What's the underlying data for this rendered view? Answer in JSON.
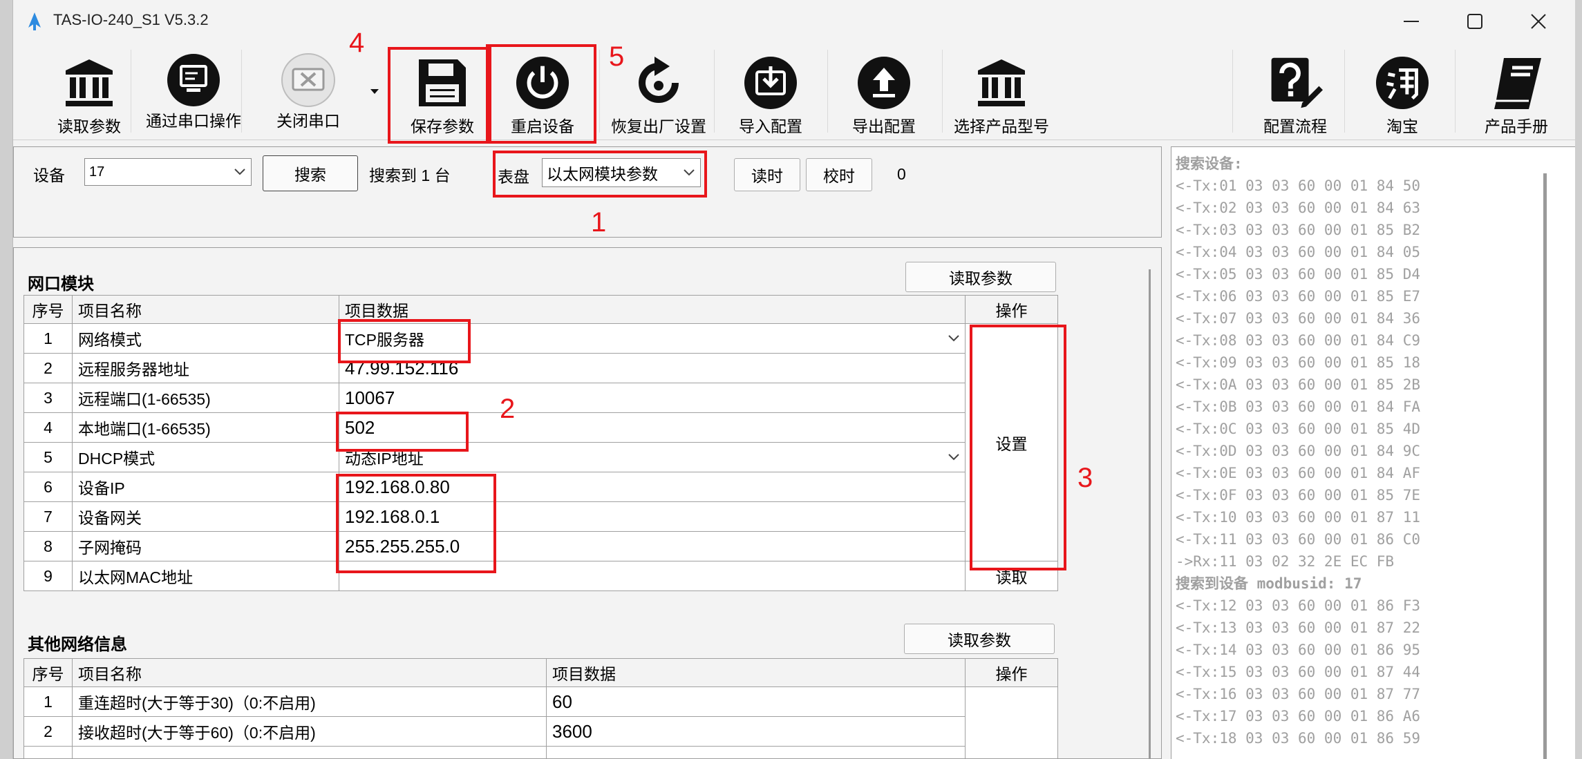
{
  "window": {
    "title": "TAS-IO-240_S1 V5.3.2",
    "controls": [
      "minimize",
      "maximize",
      "close"
    ]
  },
  "toolbar": {
    "read_params": "读取参数",
    "serial_op": "通过串口操作",
    "close_port": "关闭串口",
    "save_params": "保存参数",
    "restart_device": "重启设备",
    "factory_reset": "恢复出厂设置",
    "import_config": "导入配置",
    "export_config": "导出配置",
    "select_model": "选择产品型号",
    "config_flow": "配置流程",
    "taobao": "淘宝",
    "manual": "产品手册"
  },
  "device_bar": {
    "device_label": "设备",
    "device_value": "17",
    "search_button": "搜索",
    "found_text": "搜索到 1 台",
    "dial_label": "表盘",
    "dial_value": "以太网模块参数",
    "read_time": "读时",
    "calibrate_time": "校时",
    "counter": "0"
  },
  "annotations": {
    "n1": "1",
    "n2": "2",
    "n3": "3",
    "n4": "4",
    "n5": "5"
  },
  "network_module": {
    "title": "网口模块",
    "read_button": "读取参数",
    "headers": {
      "index": "序号",
      "name": "项目名称",
      "data": "项目数据",
      "action": "操作"
    },
    "rows": [
      {
        "index": "1",
        "name": "网络模式",
        "value": "TCP服务器"
      },
      {
        "index": "2",
        "name": "远程服务器地址",
        "value": "47.99.152.116"
      },
      {
        "index": "3",
        "name": "远程端口(1-66535)",
        "value": "10067"
      },
      {
        "index": "4",
        "name": "本地端口(1-66535)",
        "value": "502"
      },
      {
        "index": "5",
        "name": "DHCP模式",
        "value": "动态IP地址"
      },
      {
        "index": "6",
        "name": "设备IP",
        "value": "192.168.0.80"
      },
      {
        "index": "7",
        "name": "设备网关",
        "value": "192.168.0.1"
      },
      {
        "index": "8",
        "name": "子网掩码",
        "value": "255.255.255.0"
      },
      {
        "index": "9",
        "name": "以太网MAC地址",
        "value": ""
      }
    ],
    "set_button": "设置",
    "read_mac_button": "读取"
  },
  "other_network": {
    "title": "其他网络信息",
    "read_button": "读取参数",
    "headers": {
      "index": "序号",
      "name": "项目名称",
      "data": "项目数据",
      "action": "操作"
    },
    "rows": [
      {
        "index": "1",
        "name": "重连超时(大于等于30)（0:不启用)",
        "value": "60"
      },
      {
        "index": "2",
        "name": "接收超时(大于等于60)（0:不启用)",
        "value": "3600"
      }
    ]
  },
  "log": {
    "lines": [
      "搜索设备:",
      "<-Tx:01 03 03 60 00 01 84 50",
      "<-Tx:02 03 03 60 00 01 84 63",
      "<-Tx:03 03 03 60 00 01 85 B2",
      "<-Tx:04 03 03 60 00 01 84 05",
      "<-Tx:05 03 03 60 00 01 85 D4",
      "<-Tx:06 03 03 60 00 01 85 E7",
      "<-Tx:07 03 03 60 00 01 84 36",
      "<-Tx:08 03 03 60 00 01 84 C9",
      "<-Tx:09 03 03 60 00 01 85 18",
      "<-Tx:0A 03 03 60 00 01 85 2B",
      "<-Tx:0B 03 03 60 00 01 84 FA",
      "<-Tx:0C 03 03 60 00 01 85 4D",
      "<-Tx:0D 03 03 60 00 01 84 9C",
      "<-Tx:0E 03 03 60 00 01 84 AF",
      "<-Tx:0F 03 03 60 00 01 85 7E",
      "<-Tx:10 03 03 60 00 01 87 11",
      "<-Tx:11 03 03 60 00 01 86 C0",
      "->Rx:11 03 02 32 2E EC FB",
      "搜索到设备 modbusid: 17",
      "<-Tx:12 03 03 60 00 01 86 F3",
      "<-Tx:13 03 03 60 00 01 87 22",
      "<-Tx:14 03 03 60 00 01 86 95",
      "<-Tx:15 03 03 60 00 01 87 44",
      "<-Tx:16 03 03 60 00 01 87 77",
      "<-Tx:17 03 03 60 00 01 86 A6",
      "<-Tx:18 03 03 60 00 01 86 59"
    ]
  }
}
